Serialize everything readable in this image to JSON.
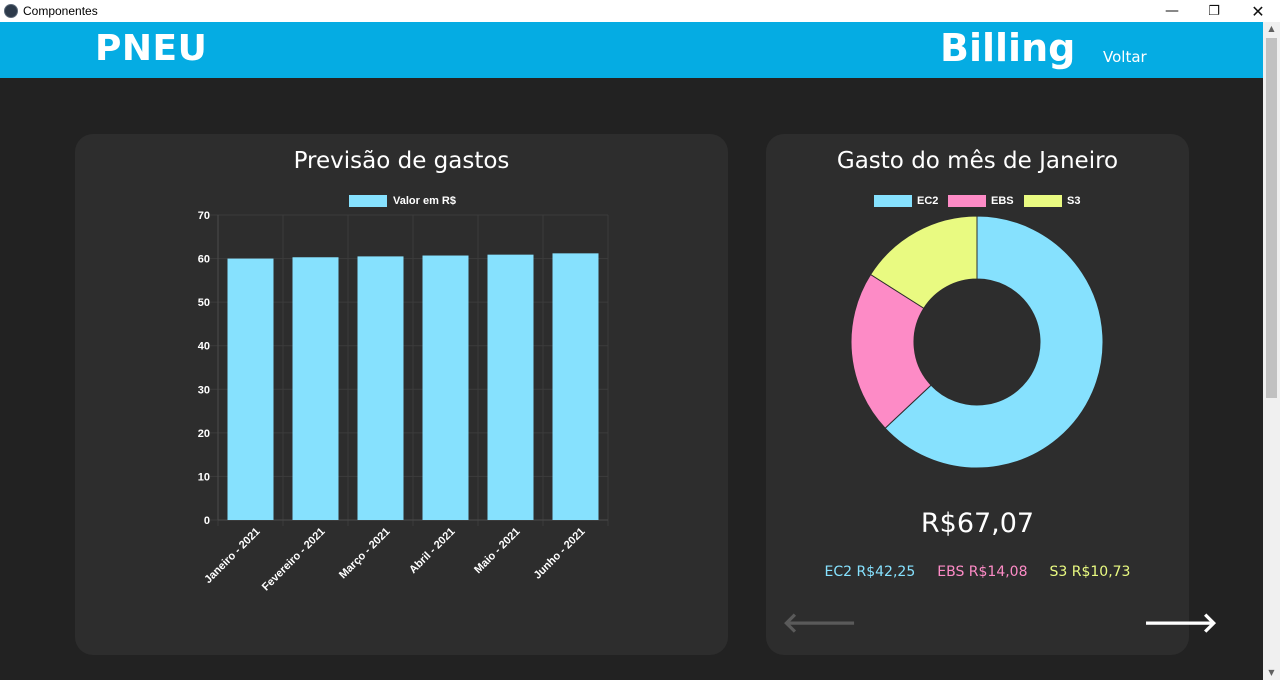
{
  "window": {
    "title": "Componentes"
  },
  "header": {
    "brand": "PNEU",
    "page_title": "Billing",
    "back_label": "Voltar"
  },
  "forecast": {
    "title": "Previsão de gastos",
    "legend_label": "Valor em R$",
    "bar_color": "#86e1fe"
  },
  "chart_data": [
    {
      "type": "bar",
      "title": "Previsão de gastos",
      "categories": [
        "Janeiro - 2021",
        "Fevereiro - 2021",
        "Março - 2021",
        "Abril - 2021",
        "Maio - 2021",
        "Junho - 2021"
      ],
      "series": [
        {
          "name": "Valor em R$",
          "values": [
            60.0,
            60.3,
            60.5,
            60.7,
            60.9,
            61.2
          ]
        }
      ],
      "ylim": [
        0,
        70
      ],
      "yticks": [
        0,
        10,
        20,
        30,
        40,
        50,
        60,
        70
      ],
      "grid": true,
      "legend": "top"
    },
    {
      "type": "pie",
      "title": "Gasto do mês de Janeiro",
      "labels": [
        "EC2",
        "EBS",
        "S3"
      ],
      "values": [
        42.25,
        14.08,
        10.73
      ],
      "colors": [
        "#86e1fe",
        "#fd8bc6",
        "#e9fa81"
      ],
      "donut": true,
      "legend": "top"
    }
  ],
  "month": {
    "title": "Gasto do mês de Janeiro",
    "total": "R$67,07",
    "breakdown": [
      {
        "label": "EC2 R$42,25"
      },
      {
        "label": "EBS R$14,08"
      },
      {
        "label": "S3 R$10,73"
      }
    ],
    "prev_icon": "arrow-left-icon",
    "next_icon": "arrow-right-icon"
  }
}
